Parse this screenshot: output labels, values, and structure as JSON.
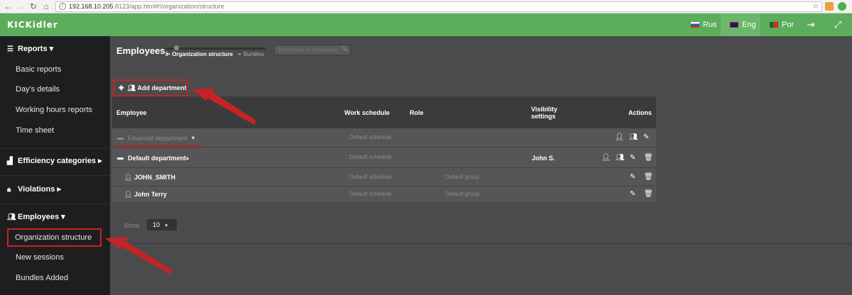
{
  "browser": {
    "back": "←",
    "forward": "→",
    "reload": "↻",
    "home": "⌂",
    "info": "i",
    "url_host": "192.168.10.205",
    "url_rest": ":8123/app.html#!/organization/structure",
    "star": "☆"
  },
  "app": {
    "logo": "KICKidler",
    "languages": [
      {
        "label": "Rus",
        "flag_colors": [
          "#ffffff",
          "#2a52be",
          "#d52b1e"
        ]
      },
      {
        "label": "Eng",
        "flag_colors": [
          "#012169",
          "#c8102e",
          "#ffffff"
        ]
      },
      {
        "label": "Por",
        "flag_colors": [
          "#046a38",
          "#da291c",
          "#ffe000"
        ]
      }
    ],
    "logout_icon": "⇥",
    "fullscreen_icon": "⤢"
  },
  "sidebar": {
    "reports": {
      "label": "Reports",
      "caret": "▾"
    },
    "report_items": [
      "Basic reports",
      "Day's details",
      "Working hours reports",
      "Time sheet"
    ],
    "efficiency": {
      "label": "Efficiency categories",
      "caret": "▸"
    },
    "violations": {
      "label": "Violations",
      "caret": "▸"
    },
    "employees": {
      "label": "Employees",
      "caret": "▾"
    },
    "employee_items": [
      "Organization structure",
      "New sessions",
      "Bundles Added"
    ]
  },
  "main": {
    "title": "Employees",
    "tab_org": "Organization structure",
    "tab_bundles": "Bundles",
    "search_placeholder": "Employee or departmer",
    "add_department": "Add department",
    "table": {
      "headers": {
        "employee": "Employee",
        "work_schedule": "Work schedule",
        "role": "Role",
        "visibility": "Visibility settings",
        "actions": "Actions"
      },
      "rows": [
        {
          "type": "department",
          "name": "Financial department",
          "caret": "▾",
          "schedule": "Default schedule",
          "group": "",
          "visibility": "",
          "dimmed": true
        },
        {
          "type": "department",
          "name": "Default department",
          "caret": "▴",
          "schedule": "Default schedule",
          "group": "",
          "visibility": "John S.",
          "dimmed": false
        },
        {
          "type": "employee",
          "name": "JOHN_SMITH",
          "schedule": "Default schedule",
          "group": "Default group"
        },
        {
          "type": "employee",
          "name": "John Terry",
          "schedule": "Default schedule",
          "group": "Default group"
        }
      ]
    },
    "show_label": "Show",
    "show_value": "10",
    "show_caret": "▾"
  },
  "colors": {
    "header_green": "#5cad5c",
    "sidebar_bg": "#1e1e20",
    "main_bg": "#4b4b4d",
    "highlight_red": "#c42424"
  }
}
